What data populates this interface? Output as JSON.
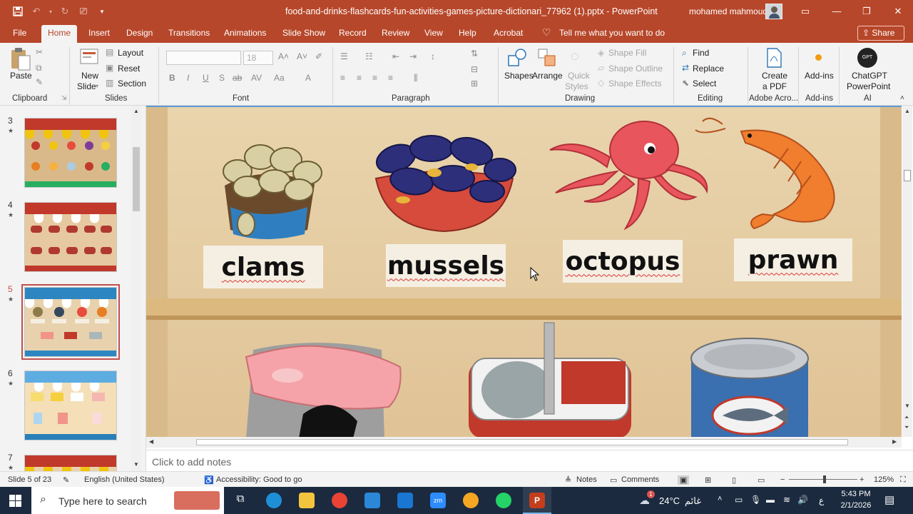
{
  "titlebar": {
    "document_title": "food-and-drinks-flashcards-fun-activities-games-picture-dictionari_77962 (1).pptx  -  PowerPoint",
    "user_name": "mohamed mahmoud"
  },
  "tabs": [
    "File",
    "Home",
    "Insert",
    "Design",
    "Transitions",
    "Animations",
    "Slide Show",
    "Record",
    "Review",
    "View",
    "Help",
    "Acrobat"
  ],
  "active_tab": "Home",
  "tell_me": "Tell me what you want to do",
  "share_label": "Share",
  "ribbon": {
    "clipboard": {
      "label": "Clipboard",
      "paste": "Paste"
    },
    "slides": {
      "label": "Slides",
      "new_slide": [
        "New",
        "Slide"
      ],
      "layout": "Layout",
      "reset": "Reset",
      "section": "Section"
    },
    "font": {
      "label": "Font",
      "font_size": "18"
    },
    "paragraph": {
      "label": "Paragraph"
    },
    "drawing": {
      "label": "Drawing",
      "shapes": "Shapes",
      "arrange": "Arrange",
      "quick_styles": [
        "Quick",
        "Styles"
      ],
      "shape_fill": "Shape Fill",
      "shape_outline": "Shape Outline",
      "shape_effects": "Shape Effects"
    },
    "editing": {
      "label": "Editing",
      "find": "Find",
      "replace": "Replace",
      "select": "Select"
    },
    "adobe": {
      "label": "Adobe Acro...",
      "create_pdf": [
        "Create",
        "a PDF"
      ]
    },
    "addins": {
      "label": "Add-ins",
      "addins_btn": "Add-ins"
    },
    "ai": {
      "label": "AI",
      "chatgpt": [
        "ChatGPT",
        "PowerPoint"
      ]
    }
  },
  "thumbnails": [
    {
      "number": "3",
      "star": "★"
    },
    {
      "number": "4",
      "star": "★"
    },
    {
      "number": "5",
      "star": "★",
      "selected": true
    },
    {
      "number": "6",
      "star": "★"
    },
    {
      "number": "7",
      "star": "★"
    }
  ],
  "slide": {
    "labels": [
      "clams",
      "mussels",
      "octopus",
      "prawn"
    ]
  },
  "notes_placeholder": "Click to add notes",
  "status": {
    "slide": "Slide 5 of 23",
    "language": "English (United States)",
    "accessibility": "Accessibility: Good to go",
    "notes": "Notes",
    "comments": "Comments",
    "zoom": "125%"
  },
  "taskbar": {
    "search_placeholder": "Type here to search",
    "weather": "24°C",
    "weather_text": "غائم",
    "lang": "ع",
    "time": "5:43 PM",
    "date": "2/1/2026",
    "notification_badge": "1"
  },
  "colors": {
    "accent": "#b7472a",
    "canvas": "#e8d2ad"
  }
}
